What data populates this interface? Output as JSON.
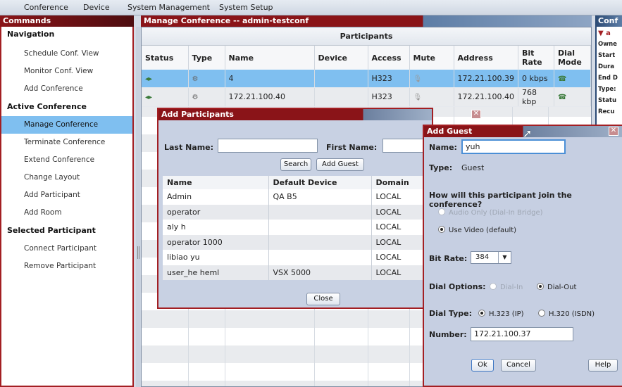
{
  "menu": [
    "Conference",
    "Device",
    "System Management",
    "System Setup"
  ],
  "commands": {
    "title": "Commands",
    "sections": [
      {
        "heading": "Navigation",
        "items": [
          "Schedule Conf. View",
          "Monitor Conf. View",
          "Add Conference"
        ]
      },
      {
        "heading": "Active Conference",
        "items": [
          "Manage Conference",
          "Terminate Conference",
          "Extend Conference",
          "Change Layout",
          "Add Participant",
          "Add Room"
        ]
      },
      {
        "heading": "Selected Participant",
        "items": [
          "Connect Participant",
          "Remove Participant"
        ]
      }
    ],
    "selected": "Manage Conference"
  },
  "main": {
    "title": "Manage Conference -- admin-testconf",
    "subtitle": "Participants",
    "columns": [
      "Status",
      "Type",
      "Name",
      "Device",
      "Access",
      "Mute",
      "Address",
      "Bit Rate",
      "Dial Mode"
    ],
    "rows": [
      {
        "name": "4",
        "device": "",
        "access": "H323",
        "address": "172.21.100.39",
        "bitrate": "0 kbps"
      },
      {
        "name": "172.21.100.40",
        "device": "",
        "access": "H323",
        "address": "172.21.100.40",
        "bitrate": "768 kbp"
      }
    ]
  },
  "right_panel": {
    "title": "Conf",
    "items": [
      "▼ a",
      "Owne",
      "Start",
      "Dura",
      "End D",
      "Type:",
      "Statu",
      "Recu"
    ]
  },
  "add_participants": {
    "title": "Add Participants",
    "last_name_label": "Last Name:",
    "first_name_label": "First Name:",
    "search_label": "Search",
    "add_guest_label": "Add Guest",
    "columns": [
      "Name",
      "Default Device",
      "Domain"
    ],
    "rows": [
      {
        "name": "Admin",
        "device": "QA B5",
        "domain": "LOCAL"
      },
      {
        "name": "operator",
        "device": "",
        "domain": "LOCAL"
      },
      {
        "name": "aly h",
        "device": "",
        "domain": "LOCAL"
      },
      {
        "name": "operator 1000",
        "device": "",
        "domain": "LOCAL"
      },
      {
        "name": "libiao yu",
        "device": "",
        "domain": "LOCAL"
      },
      {
        "name": "user_he heml",
        "device": "VSX 5000",
        "domain": "LOCAL"
      }
    ],
    "close_label": "Close"
  },
  "add_guest": {
    "title": "Add Guest",
    "name_label": "Name:",
    "name_value": "yuh",
    "type_label": "Type:",
    "type_value": "Guest",
    "question": "How will this participant join the conference?",
    "audio_only": "Audio Only (Dial-In Bridge)",
    "use_video": "Use Video (default)",
    "bitrate_label": "Bit Rate:",
    "bitrate_value": "384",
    "dial_options_label": "Dial Options:",
    "dial_in": "Dial-In",
    "dial_out": "Dial-Out",
    "dial_type_label": "Dial Type:",
    "h323": "H.323 (IP)",
    "h320": "H.320 (ISDN)",
    "number_label": "Number:",
    "number_value": "172.21.100.37",
    "ok_label": "Ok",
    "cancel_label": "Cancel",
    "help_label": "Help"
  }
}
